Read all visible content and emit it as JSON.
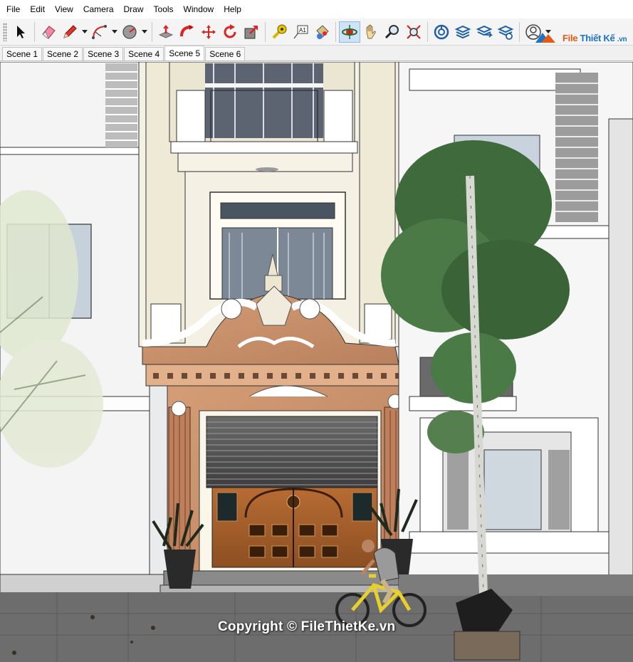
{
  "menu": [
    "File",
    "Edit",
    "View",
    "Camera",
    "Draw",
    "Tools",
    "Window",
    "Help"
  ],
  "toolbar": {
    "tools": [
      {
        "icon": "select-arrow-icon"
      },
      {
        "icon": "eraser-icon"
      },
      {
        "icon": "pencil-line-icon"
      },
      {
        "icon": "arc-icon"
      },
      {
        "icon": "shape-circle-icon"
      },
      {
        "icon": "push-pull-icon"
      },
      {
        "icon": "follow-me-icon"
      },
      {
        "icon": "move-icon"
      },
      {
        "icon": "rotate-icon"
      },
      {
        "icon": "scale-icon"
      },
      {
        "icon": "tape-measure-icon"
      },
      {
        "icon": "text-icon",
        "label": "A1"
      },
      {
        "icon": "paint-bucket-icon"
      },
      {
        "icon": "orbit-icon"
      },
      {
        "icon": "pan-icon"
      },
      {
        "icon": "zoom-icon"
      },
      {
        "icon": "zoom-extents-icon"
      },
      {
        "icon": "warehouse-icon"
      },
      {
        "icon": "extension-warehouse-icon"
      },
      {
        "icon": "layout-send-icon"
      },
      {
        "icon": "extension-manager-icon"
      },
      {
        "icon": "account-icon"
      }
    ]
  },
  "brand": {
    "part1": "File",
    "part2": "Thiết Kế",
    "suffix": ".vn"
  },
  "scenes": [
    "Scene 1",
    "Scene 2",
    "Scene 3",
    "Scene 4",
    "Scene 5",
    "Scene 6"
  ],
  "active_scene": "Scene 5",
  "viewport": {
    "copyright": "Copyright © FileThietKe.vn"
  },
  "colors": {
    "accent": "#1a73c9",
    "active_tool_bg": "#cfe3f7",
    "facade_cream": "#f4f1e4",
    "stone": "#c9906a",
    "door_wood": "#a6602b"
  }
}
